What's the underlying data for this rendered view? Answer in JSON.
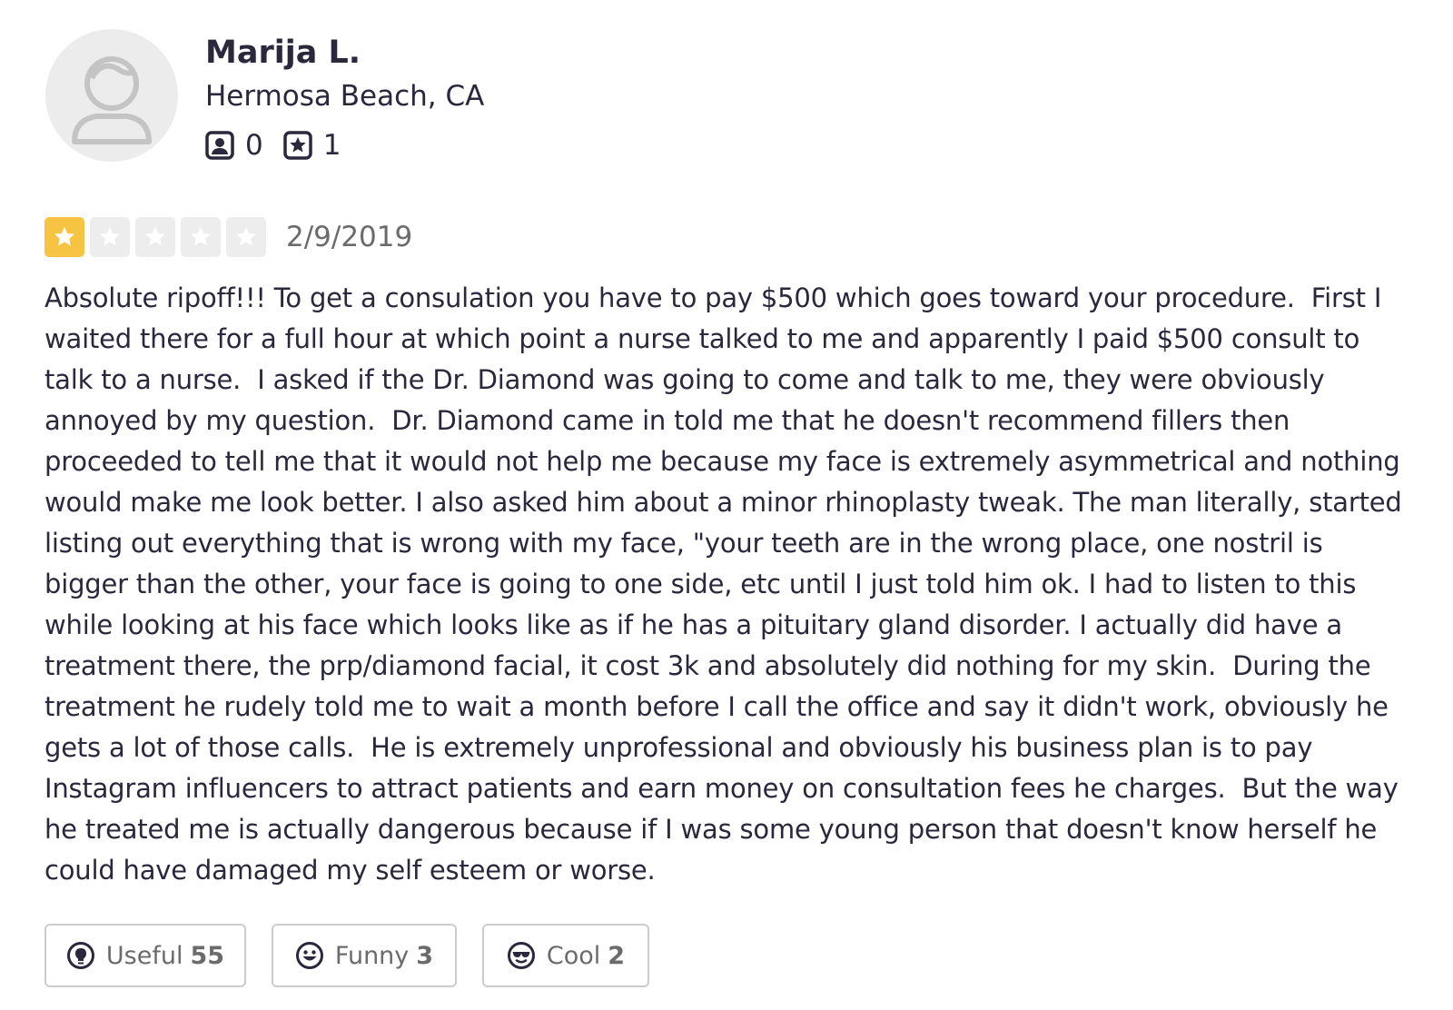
{
  "user": {
    "name": "Marija L.",
    "location": "Hermosa Beach, CA",
    "friends_count": "0",
    "reviews_count": "1"
  },
  "review": {
    "rating": 1,
    "max_rating": 5,
    "date": "2/9/2019",
    "text": "Absolute ripoff!!! To get a consulation you have to pay $500 which goes toward your procedure.  First I waited there for a full hour at which point a nurse talked to me and apparently I paid $500 consult to talk to a nurse.  I asked if the Dr. Diamond was going to come and talk to me, they were obviously annoyed by my question.  Dr. Diamond came in told me that he doesn't recommend fillers then proceeded to tell me that it would not help me because my face is extremely asymmetrical and nothing would make me look better. I also asked him about a minor rhinoplasty tweak. The man literally, started listing out everything that is wrong with my face, \"your teeth are in the wrong place, one nostril is bigger than the other, your face is going to one side, etc until I just told him ok. I had to listen to this while looking at his face which looks like as if he has a pituitary gland disorder. I actually did have a treatment there, the prp/diamond facial, it cost 3k and absolutely did nothing for my skin.  During the treatment he rudely told me to wait a month before I call the office and say it didn't work, obviously he gets a lot of those calls.  He is extremely unprofessional and obviously his business plan is to pay Instagram influencers to attract patients and earn money on consultation fees he charges.  But the way he treated me is actually dangerous because if I was some young person that doesn't know herself he could have damaged my self esteem or worse."
  },
  "reactions": {
    "useful": {
      "label": "Useful",
      "count": "55",
      "icon": "lightbulb-icon"
    },
    "funny": {
      "label": "Funny",
      "count": "3",
      "icon": "smiley-icon"
    },
    "cool": {
      "label": "Cool",
      "count": "2",
      "icon": "sunglasses-icon"
    }
  },
  "colors": {
    "star_filled": "#f6c343",
    "star_empty": "#ededed",
    "text": "#2b273c",
    "muted": "#6b6b6b",
    "border": "#cccccc"
  }
}
